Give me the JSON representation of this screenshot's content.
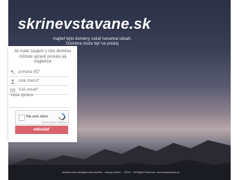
{
  "site": {
    "title": "skrinevstavane.sk",
    "subtitle_line1": "majiteľ tejto domény zatiaľ nenahral obsah.",
    "subtitle_line2": "Doména može byť na predaj"
  },
  "form": {
    "intro": "Ak máte záujem o túto doménu môžete spraviť ponuku jej majiteľovi",
    "fields": [
      {
        "label": "ponuka (€)*",
        "icon": "gavel-icon"
      },
      {
        "label": "celé meno*",
        "icon": "user-icon"
      },
      {
        "label": "Váš email*",
        "icon": "envelope-icon"
      }
    ],
    "message_placeholder": "Vaša správa",
    "captcha_label": "Nie som robot",
    "captcha_legal": "Ochrana súkromia · Podmienky",
    "submit_label": "odoslať"
  },
  "footer": {
    "link1": "doména bola zaregistrovaná službou",
    "link2": "nákupy domén",
    "copyright": "©2017 · All Rights Reserved. www.kupadomeny.sk"
  },
  "colors": {
    "submit_bg": "#d9626b",
    "footer_bg": "#1b1b22"
  }
}
